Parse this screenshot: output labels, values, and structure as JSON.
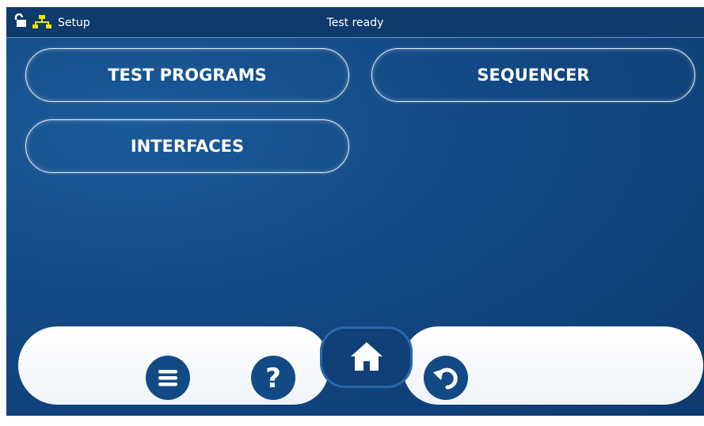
{
  "statusbar": {
    "mode_label": "Setup",
    "status_text": "Test ready",
    "icons": [
      "lock-open-icon",
      "network-icon"
    ],
    "network_color": "#f2e600"
  },
  "menu": {
    "test_programs": "TEST PROGRAMS",
    "sequencer": "SEQUENCER",
    "interfaces": "INTERFACES"
  },
  "navbar": {
    "icons": [
      "menu-lines-icon",
      "help-question-icon",
      "home-icon",
      "back-undo-icon"
    ]
  },
  "colors": {
    "background": "#134985",
    "accent_yellow": "#f2e600",
    "nav_bar": "#f0f3f8",
    "icon_blue": "#124a86"
  }
}
